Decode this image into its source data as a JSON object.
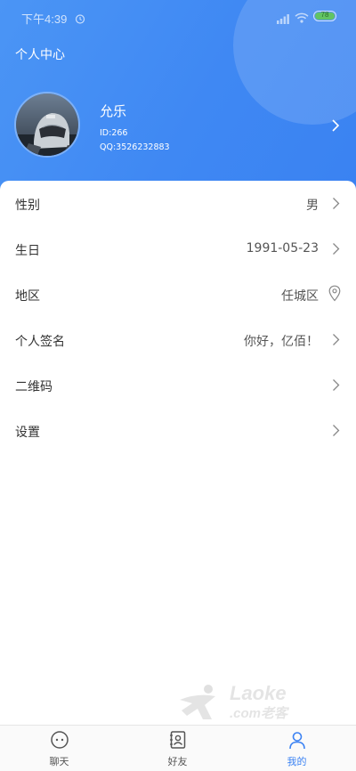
{
  "status_bar": {
    "time": "下午4:39",
    "battery": "78"
  },
  "header": {
    "title": "个人中心"
  },
  "profile": {
    "name": "允乐",
    "id": "ID:266",
    "qq": "QQ:3526232883"
  },
  "settings": [
    {
      "label": "性别",
      "value": "男",
      "icon": "chevron-right-icon"
    },
    {
      "label": "生日",
      "value": "1991-05-23",
      "icon": "chevron-right-icon"
    },
    {
      "label": "地区",
      "value": "任城区",
      "icon": "location-pin-icon"
    },
    {
      "label": "个人签名",
      "value": "你好，亿佰！",
      "icon": "chevron-right-icon"
    },
    {
      "label": "二维码",
      "value": "",
      "icon": "chevron-right-icon"
    },
    {
      "label": "设置",
      "value": "",
      "icon": "chevron-right-icon"
    }
  ],
  "watermark": {
    "brand": "Laoke",
    "sub": ".com老客"
  },
  "tabs": [
    {
      "label": "聊天",
      "icon": "chat-icon",
      "active": false
    },
    {
      "label": "好友",
      "icon": "contacts-icon",
      "active": false
    },
    {
      "label": "我的",
      "icon": "user-icon",
      "active": true
    }
  ],
  "colors": {
    "accent": "#3b82f3",
    "header_gradient_start": "#4b95f5",
    "battery": "#62c463"
  }
}
